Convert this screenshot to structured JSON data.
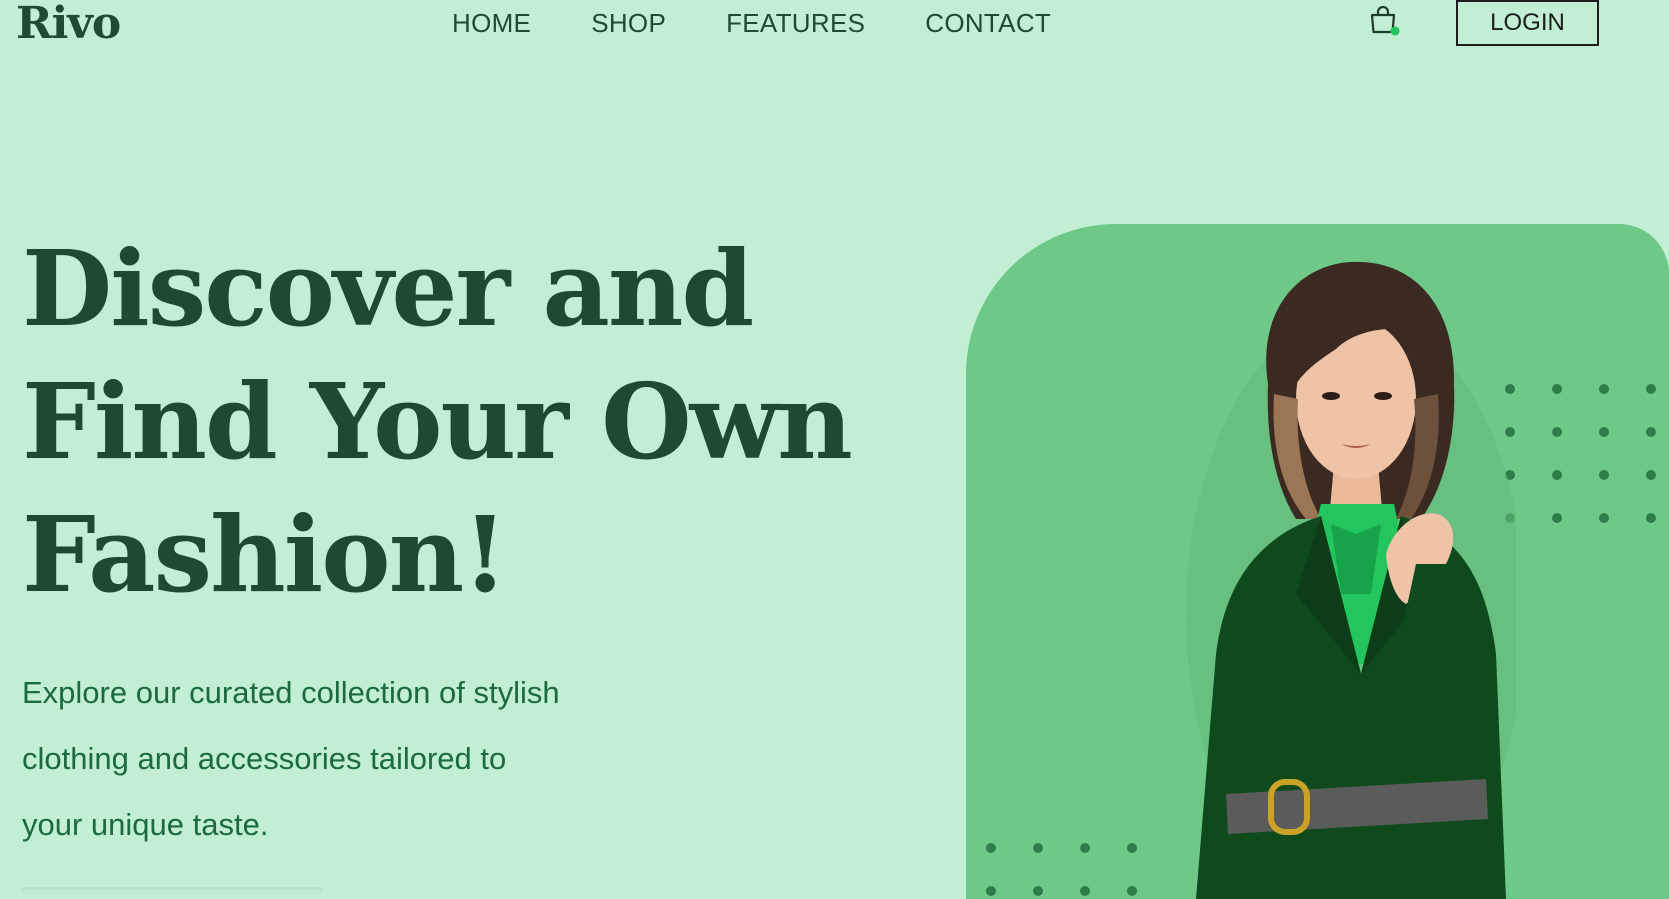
{
  "brand": {
    "logo_text": "Rivo"
  },
  "nav": {
    "items": [
      {
        "label": "HOME"
      },
      {
        "label": "SHOP"
      },
      {
        "label": "FEATURES"
      },
      {
        "label": "CONTACT"
      }
    ]
  },
  "header": {
    "cart_icon": "shopping-bag-icon",
    "login_label": "LOGIN"
  },
  "hero": {
    "headline_lines": [
      "Discover and",
      "Find Your Own",
      "Fashion!"
    ],
    "tagline_lines": [
      "Explore our curated collection of stylish",
      "clothing and accessories tailored to",
      "your unique taste."
    ]
  },
  "colors": {
    "background": "#c2eed4",
    "card": "#6ec888",
    "heading": "#1e4a31",
    "tagline": "#1c6a3f",
    "cart_badge": "#22c55e",
    "dots": "#2f7d4a"
  }
}
